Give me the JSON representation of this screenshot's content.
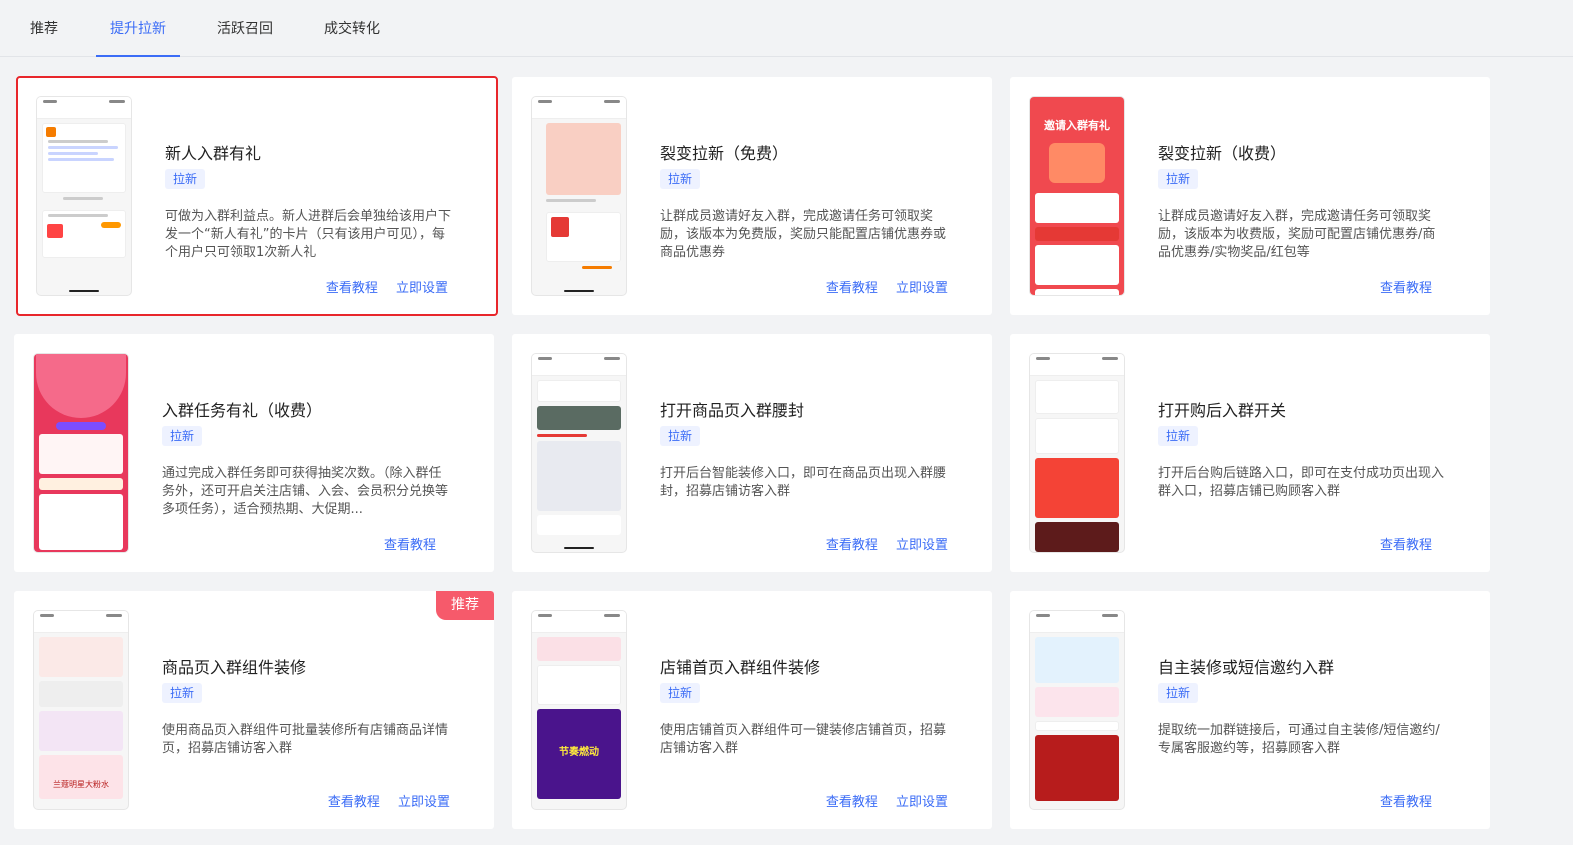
{
  "tabs": [
    {
      "label": "推荐"
    },
    {
      "label": "提升拉新"
    },
    {
      "label": "活跃召回"
    },
    {
      "label": "成交转化"
    }
  ],
  "active_tab": "提升拉新",
  "accent_color": "#3b6cf6",
  "cards": [
    {
      "title": "新人入群有礼",
      "tag": "拉新",
      "desc": "可做为入群利益点。新人进群后会单独给该用户下发一个“新人有礼”的卡片（只有该用户可见），每个用户只可领取1次新人礼",
      "link_tutorial": "查看教程",
      "link_setup": "立即设置",
      "selected": true
    },
    {
      "title": "裂变拉新（免费）",
      "tag": "拉新",
      "desc": "让群成员邀请好友入群，完成邀请任务可领取奖励，该版本为免费版，奖励只能配置店铺优惠券或商品优惠券",
      "link_tutorial": "查看教程",
      "link_setup": "立即设置"
    },
    {
      "title": "裂变拉新（收费）",
      "tag": "拉新",
      "desc": "让群成员邀请好友入群，完成邀请任务可领取奖励，该版本为收费版，奖励可配置店铺优惠券/商品优惠券/实物奖品/红包等",
      "link_tutorial": "查看教程",
      "thumb_text": "邀请入群有礼"
    },
    {
      "title": "入群任务有礼（收费）",
      "tag": "拉新",
      "desc": "通过完成入群任务即可获得抽奖次数。（除入群任务外，还可开启关注店铺、入会、会员积分兑换等多项任务），适合预热期、大促期...",
      "link_tutorial": "查看教程"
    },
    {
      "title": "打开商品页入群腰封",
      "tag": "拉新",
      "desc": "打开后台智能装修入口，即可在商品页出现入群腰封，招募店铺访客入群",
      "link_tutorial": "查看教程",
      "link_setup": "立即设置"
    },
    {
      "title": "打开购后入群开关",
      "tag": "拉新",
      "desc": "打开后台购后链路入口，即可在支付成功页出现入群入口，招募店铺已购顾客入群",
      "link_tutorial": "查看教程"
    },
    {
      "title": "商品页入群组件装修",
      "tag": "拉新",
      "desc": "使用商品页入群组件可批量装修所有店铺商品详情页，招募店铺访客入群",
      "link_tutorial": "查看教程",
      "link_setup": "立即设置",
      "badge": "推荐",
      "thumb_text": "兰蔻明星大粉水"
    },
    {
      "title": "店铺首页入群组件装修",
      "tag": "拉新",
      "desc": "使用店铺首页入群组件可一键装修店铺首页，招募店铺访客入群",
      "link_tutorial": "查看教程",
      "link_setup": "立即设置",
      "thumb_text": "节奏燃动"
    },
    {
      "title": "自主装修或短信邀约入群",
      "tag": "拉新",
      "desc": "提取统一加群链接后，可通过自主装修/短信邀约/专属客服邀约等，招募顾客入群",
      "link_tutorial": "查看教程"
    }
  ]
}
